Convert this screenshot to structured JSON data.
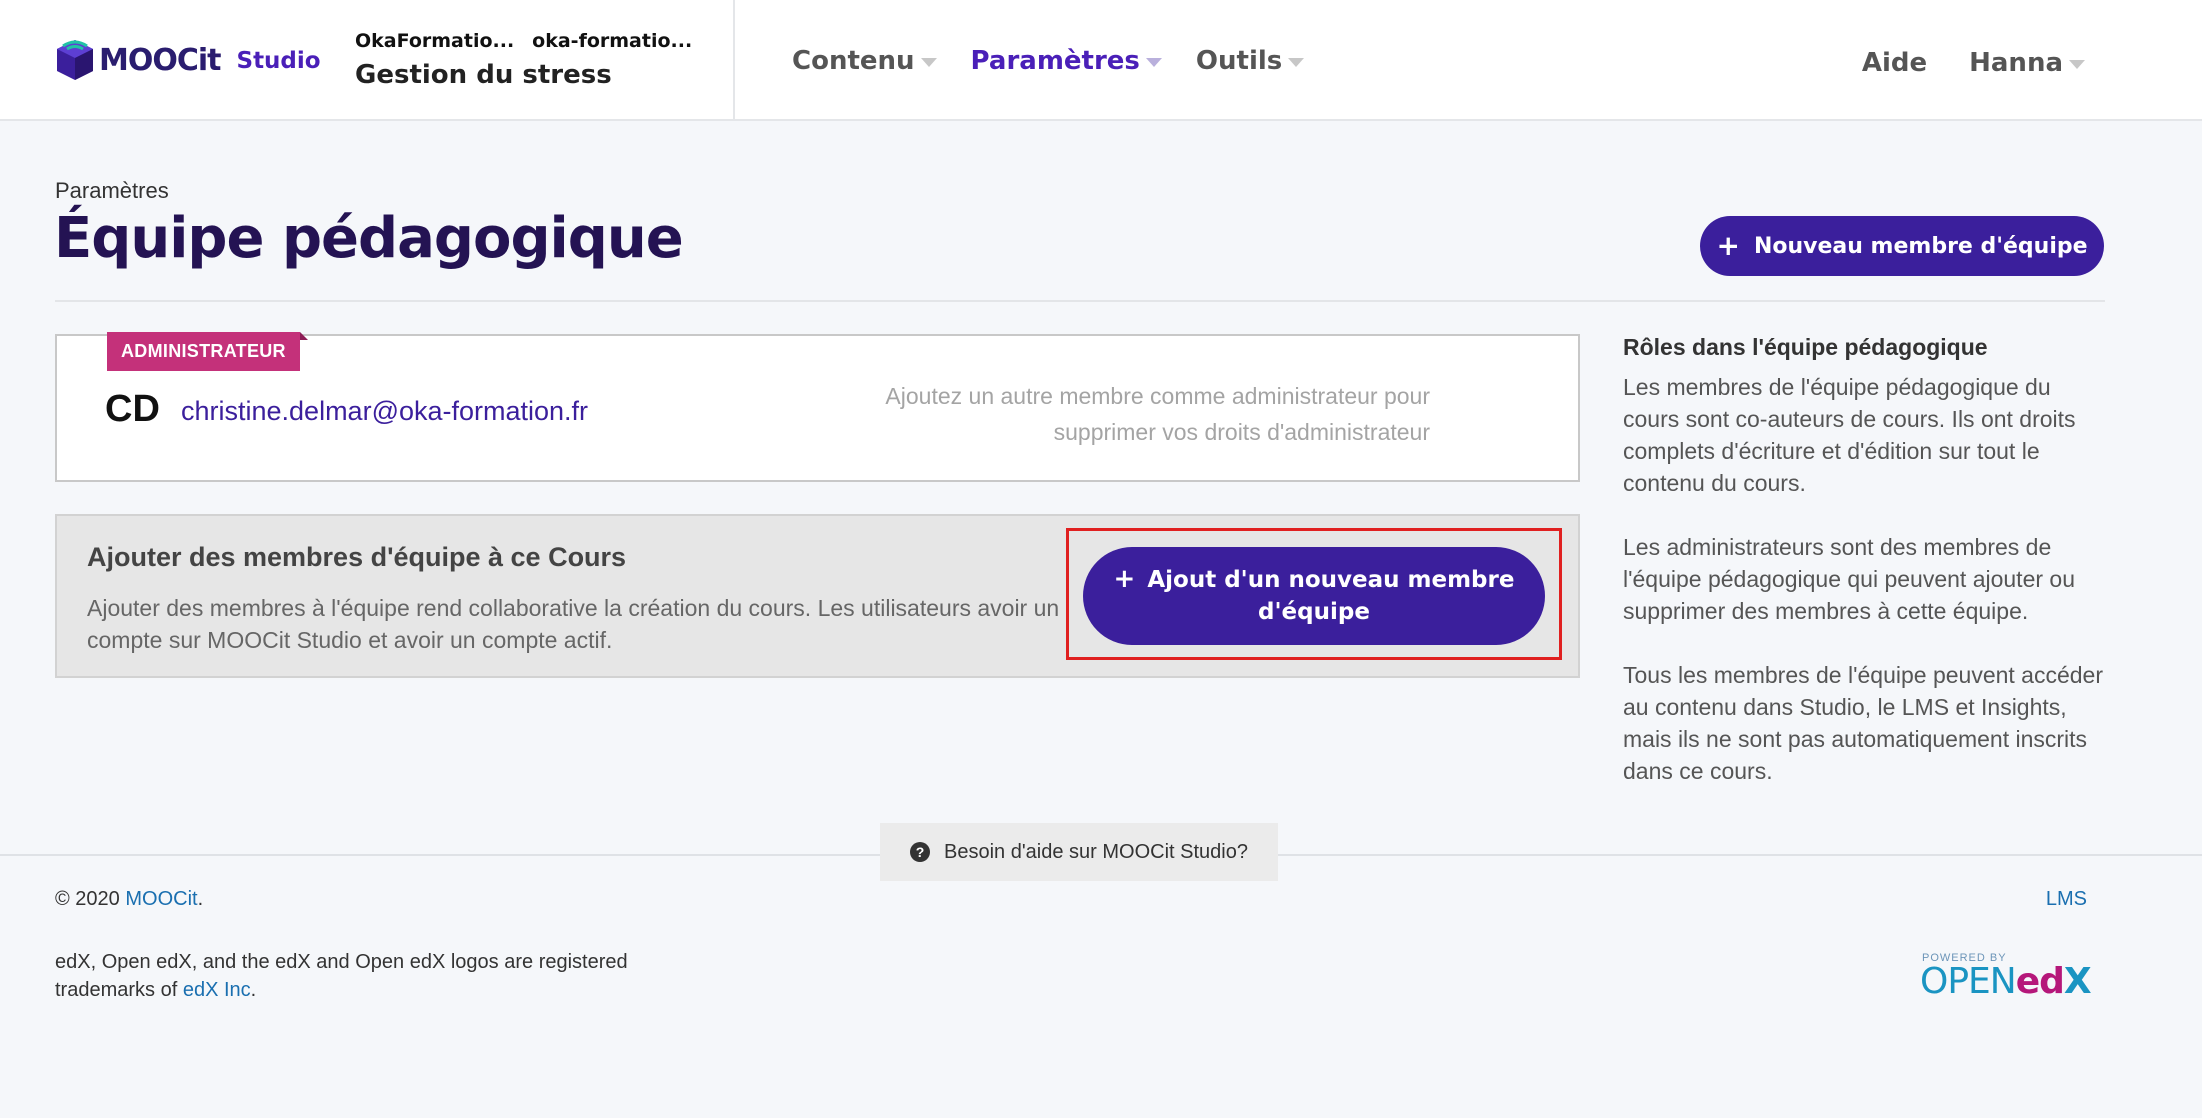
{
  "header": {
    "brand": "MOOCit",
    "product": "Studio",
    "course_org": "OkaFormatio...",
    "course_number": "oka-formatio...",
    "course_title": "Gestion du stress",
    "nav": [
      {
        "label": "Contenu"
      },
      {
        "label": "Paramètres",
        "active": true
      },
      {
        "label": "Outils"
      }
    ],
    "help_label": "Aide",
    "user_label": "Hanna"
  },
  "page": {
    "subtitle": "Paramètres",
    "title": "Équipe pédagogique",
    "new_member_button": "Nouveau membre d'équipe"
  },
  "member": {
    "role_badge": "ADMINISTRATEUR",
    "initials": "CD",
    "email": "christine.delmar@oka-formation.fr",
    "note": "Ajoutez un autre membre comme administrateur pour supprimer vos droits d'administrateur"
  },
  "add_panel": {
    "title": "Ajouter des membres d'équipe à ce Cours",
    "text": "Ajouter des membres à l'équipe rend collaborative la création du cours. Les utilisateurs avoir un compte sur MOOCit Studio et avoir un compte actif.",
    "button_line1": "Ajout d'un nouveau membre",
    "button_line2": "d'équipe"
  },
  "sidebar": {
    "title": "Rôles dans l'équipe pédagogique",
    "paragraphs": [
      "Les membres de l'équipe pédagogique du cours sont co-auteurs de cours. Ils ont droits complets d'écriture et d'édition sur tout le contenu du cours.",
      "Les administrateurs sont des membres de l'équipe pédagogique qui peuvent ajouter ou supprimer des membres à cette équipe.",
      "Tous les membres de l'équipe peuvent accéder au contenu dans Studio, le LMS et Insights, mais ils ne sont pas automatiquement inscrits dans ce cours."
    ]
  },
  "footer": {
    "help_tab": "Besoin d'aide sur MOOCit Studio?",
    "copyright_prefix": "© 2020",
    "copyright_link": "MOOCit",
    "copyright_suffix": ".",
    "lms_link": "LMS",
    "trademark_text": "edX, Open edX, and the edX and Open edX logos are registered trademarks of",
    "trademark_link": "edX Inc",
    "trademark_suffix": ".",
    "powered_by": "POWERED BY",
    "openedx_open": "OPEN",
    "openedx_ed": "ed",
    "openedx_x": "X"
  },
  "colors": {
    "brand_purple": "#3b1f9c",
    "title_dark": "#241353",
    "badge_pink": "#c4317a",
    "highlight_red": "#e02020",
    "link_blue": "#1a6fb0"
  },
  "icons": {
    "logo": "moocit-cube-icon",
    "plus": "plus-icon",
    "caret": "caret-down-icon",
    "help": "question-circle-icon"
  }
}
